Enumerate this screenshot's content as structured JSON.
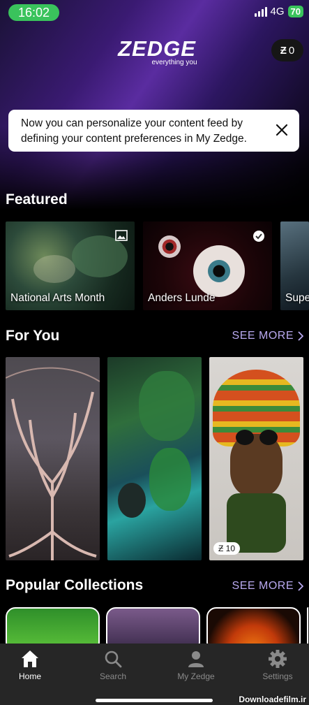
{
  "status": {
    "time": "16:02",
    "network": "4G",
    "battery": "70"
  },
  "header": {
    "logo": "ZEDGE",
    "tagline": "everything you",
    "coins": "0"
  },
  "notice": {
    "text": "Now you can personalize your content feed by defining your content preferences in My Zedge."
  },
  "featured": {
    "title": "Featured",
    "items": [
      {
        "label": "National Arts Month",
        "icon": "image-icon"
      },
      {
        "label": "Anders Lunde",
        "icon": "verified-badge-icon"
      },
      {
        "label": "Supe"
      }
    ]
  },
  "for_you": {
    "title": "For You",
    "see_more": "SEE MORE",
    "price": "10"
  },
  "popular": {
    "title": "Popular Collections",
    "see_more": "SEE MORE"
  },
  "nav": {
    "home": "Home",
    "search": "Search",
    "my_zedge": "My Zedge",
    "settings": "Settings"
  },
  "watermark": "Downloadefilm.ir",
  "colors": {
    "accent": "#b9a9f0",
    "status_green": "#3ac35c",
    "nav_bg": "#262626"
  }
}
